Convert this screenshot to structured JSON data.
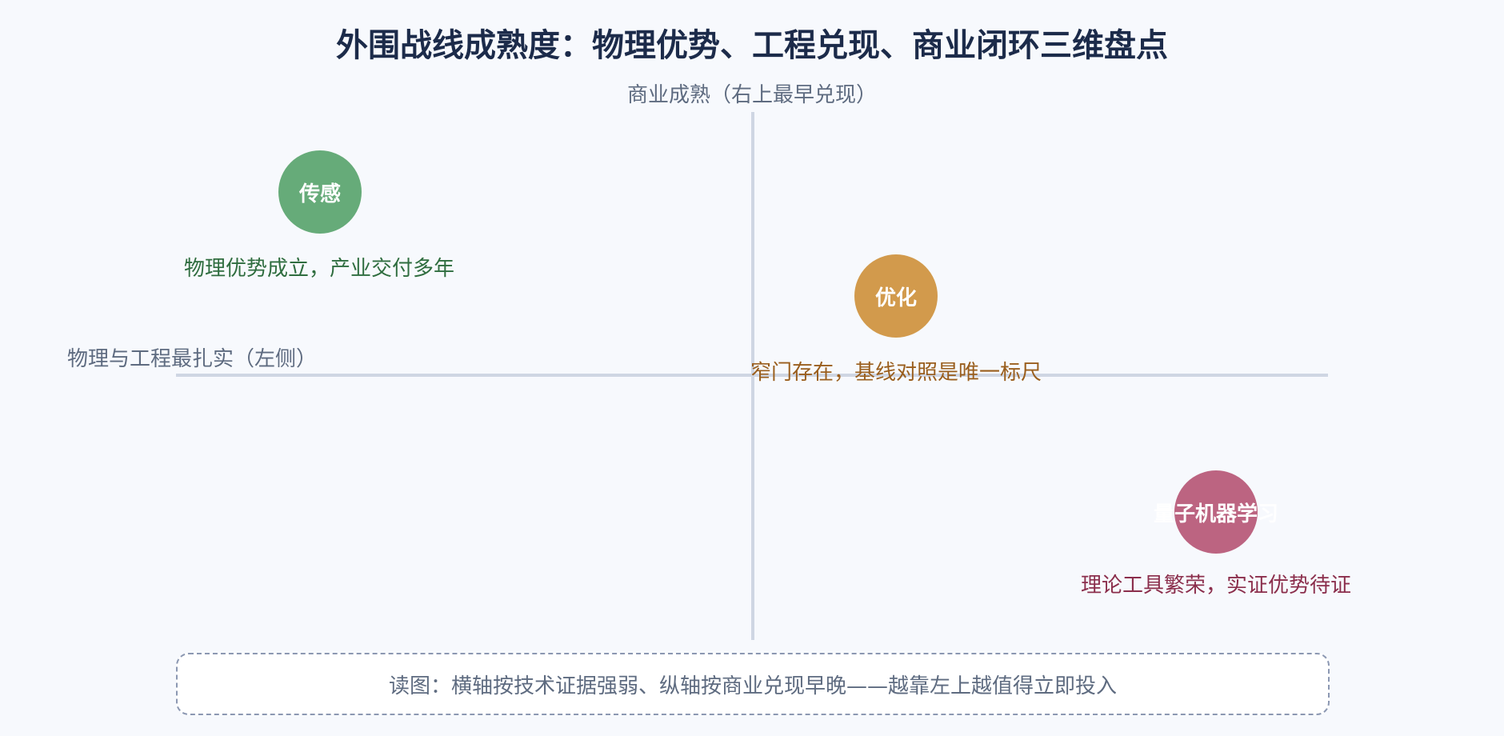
{
  "title": "外围战线成熟度：物理优势、工程兑现、商业闭环三维盘点",
  "axes": {
    "top_label": "商业成熟（右上最早兑现）",
    "left_label": "物理与工程最扎实（左侧）"
  },
  "items": [
    {
      "name": "传感",
      "note": "物理优势成立，产业交付多年",
      "color": "#66ab79",
      "note_color": "#2f6d3f"
    },
    {
      "name": "优化",
      "note": "窄门存在，基线对照是唯一标尺",
      "color": "#d29a4c",
      "note_color": "#9a5e1d"
    },
    {
      "name": "量子机器学习",
      "note": "理论工具繁荣，实证优势待证",
      "color": "#bc6481",
      "note_color": "#8b2e4c"
    }
  ],
  "reading_note": "读图：横轴按技术证据强弱、纵轴按商业兑现早晚——越靠左上越值得立即投入"
}
